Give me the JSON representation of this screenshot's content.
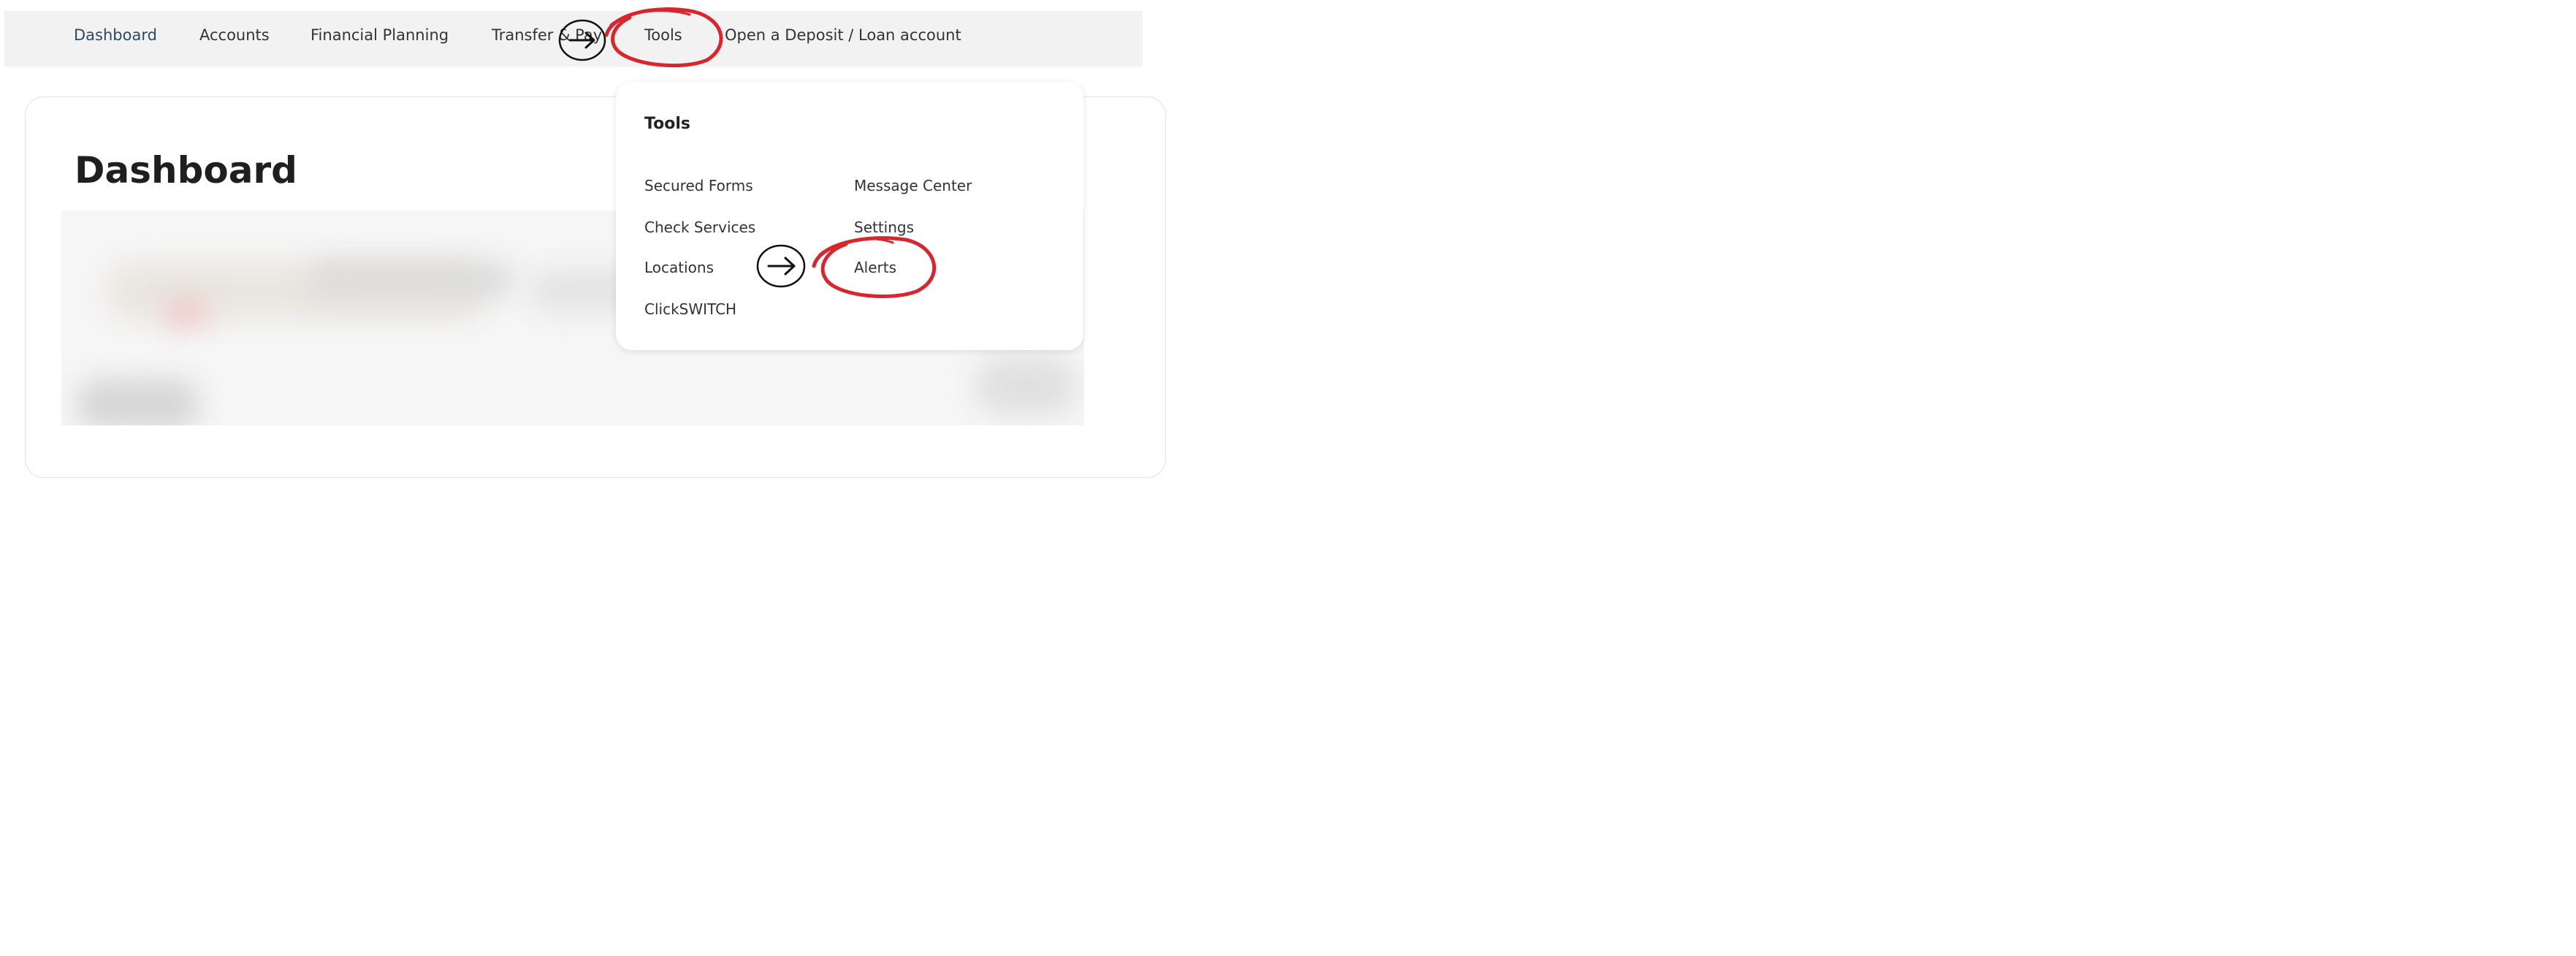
{
  "nav": {
    "items": [
      {
        "label": "Dashboard"
      },
      {
        "label": "Accounts"
      },
      {
        "label": "Financial Planning"
      },
      {
        "label": "Transfer & Pay"
      },
      {
        "label": "Tools"
      },
      {
        "label": "Open a Deposit / Loan account"
      }
    ]
  },
  "page": {
    "title": "Dashboard"
  },
  "tools_menu": {
    "heading": "Tools",
    "left_column": [
      "Secured Forms",
      "Check Services",
      "Locations",
      "ClickSWITCH"
    ],
    "right_column": [
      "Message Center",
      "Settings",
      "Alerts"
    ]
  },
  "annotations": {
    "arrow_icon": "right-arrow-icon",
    "highlight_color": "#d9262c"
  },
  "colors": {
    "nav_bg": "#f2f2f2",
    "active_nav": "#2e4a63",
    "highlight": "#d9262c"
  }
}
